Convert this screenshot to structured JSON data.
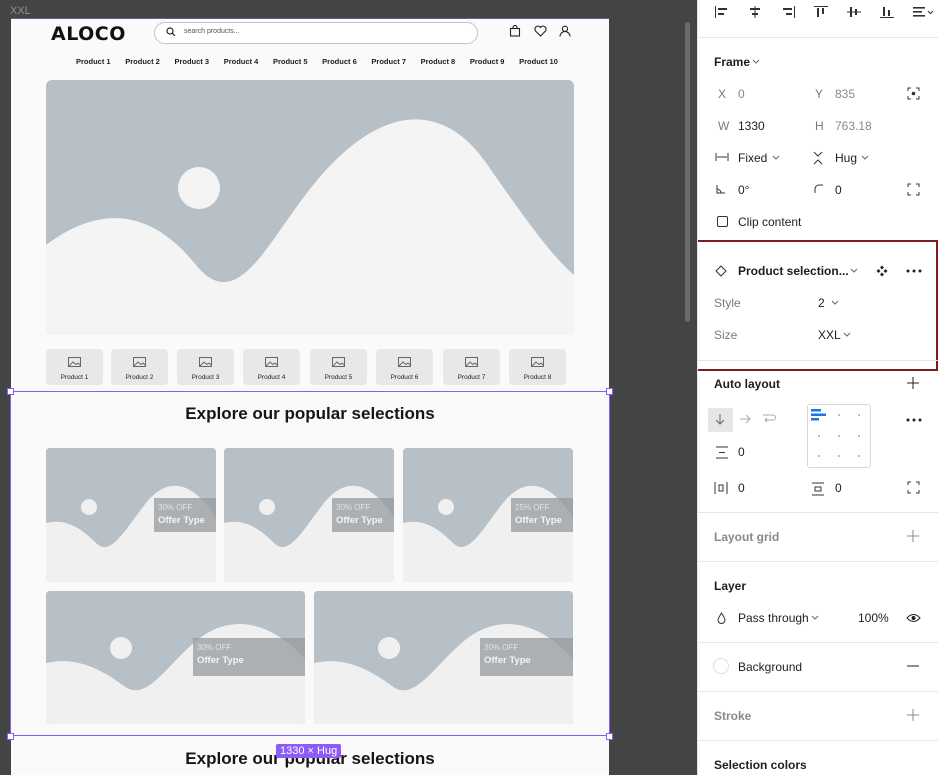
{
  "canvas": {
    "frame_label": "XXL",
    "size_badge": "1330 × Hug",
    "site": {
      "logo": "ALOCO",
      "search_placeholder": "search products...",
      "nav_items": [
        "Product 1",
        "Product 2",
        "Product 3",
        "Product 4",
        "Product 5",
        "Product 6",
        "Product 7",
        "Product 8",
        "Product 9",
        "Product 10"
      ],
      "thumbnails": [
        "Product 1",
        "Product 2",
        "Product 3",
        "Product 4",
        "Product 5",
        "Product 6",
        "Product 7",
        "Product 8"
      ],
      "section_title": "Explore our popular selections",
      "section_title_2": "Explore our popular selections",
      "cards": [
        {
          "pct": "30% OFF",
          "type": "Offer Type"
        },
        {
          "pct": "30% OFF",
          "type": "Offer Type"
        },
        {
          "pct": "25% OFF",
          "type": "Offer Type"
        },
        {
          "pct": "30% OFF",
          "type": "Offer Type"
        },
        {
          "pct": "30% OFF",
          "type": "Offer Type"
        }
      ]
    }
  },
  "panel": {
    "frame": {
      "title": "Frame",
      "x_label": "X",
      "x_value": "0",
      "y_label": "Y",
      "y_value": "835",
      "w_label": "W",
      "w_value": "1330",
      "h_label": "H",
      "h_value": "763.18",
      "width_mode": "Fixed",
      "height_mode": "Hug",
      "rotation": "0°",
      "radius": "0",
      "clip_content": "Clip content"
    },
    "component": {
      "name": "Product selection...",
      "style_label": "Style",
      "style_value": "2",
      "size_label": "Size",
      "size_value": "XXL"
    },
    "auto_layout": {
      "title": "Auto layout",
      "gap": "0",
      "padding_h": "0",
      "padding_v": "0"
    },
    "layout_grid": "Layout grid",
    "layer": {
      "title": "Layer",
      "blend": "Pass through",
      "opacity": "100%"
    },
    "background": "Background",
    "stroke": "Stroke",
    "selection_colors": "Selection colors"
  },
  "colors": {
    "canvas_bg": "#434545",
    "selection": "#8b5cf6",
    "placeholder": "#b7c0c6",
    "highlight": "#7a1d1d"
  }
}
